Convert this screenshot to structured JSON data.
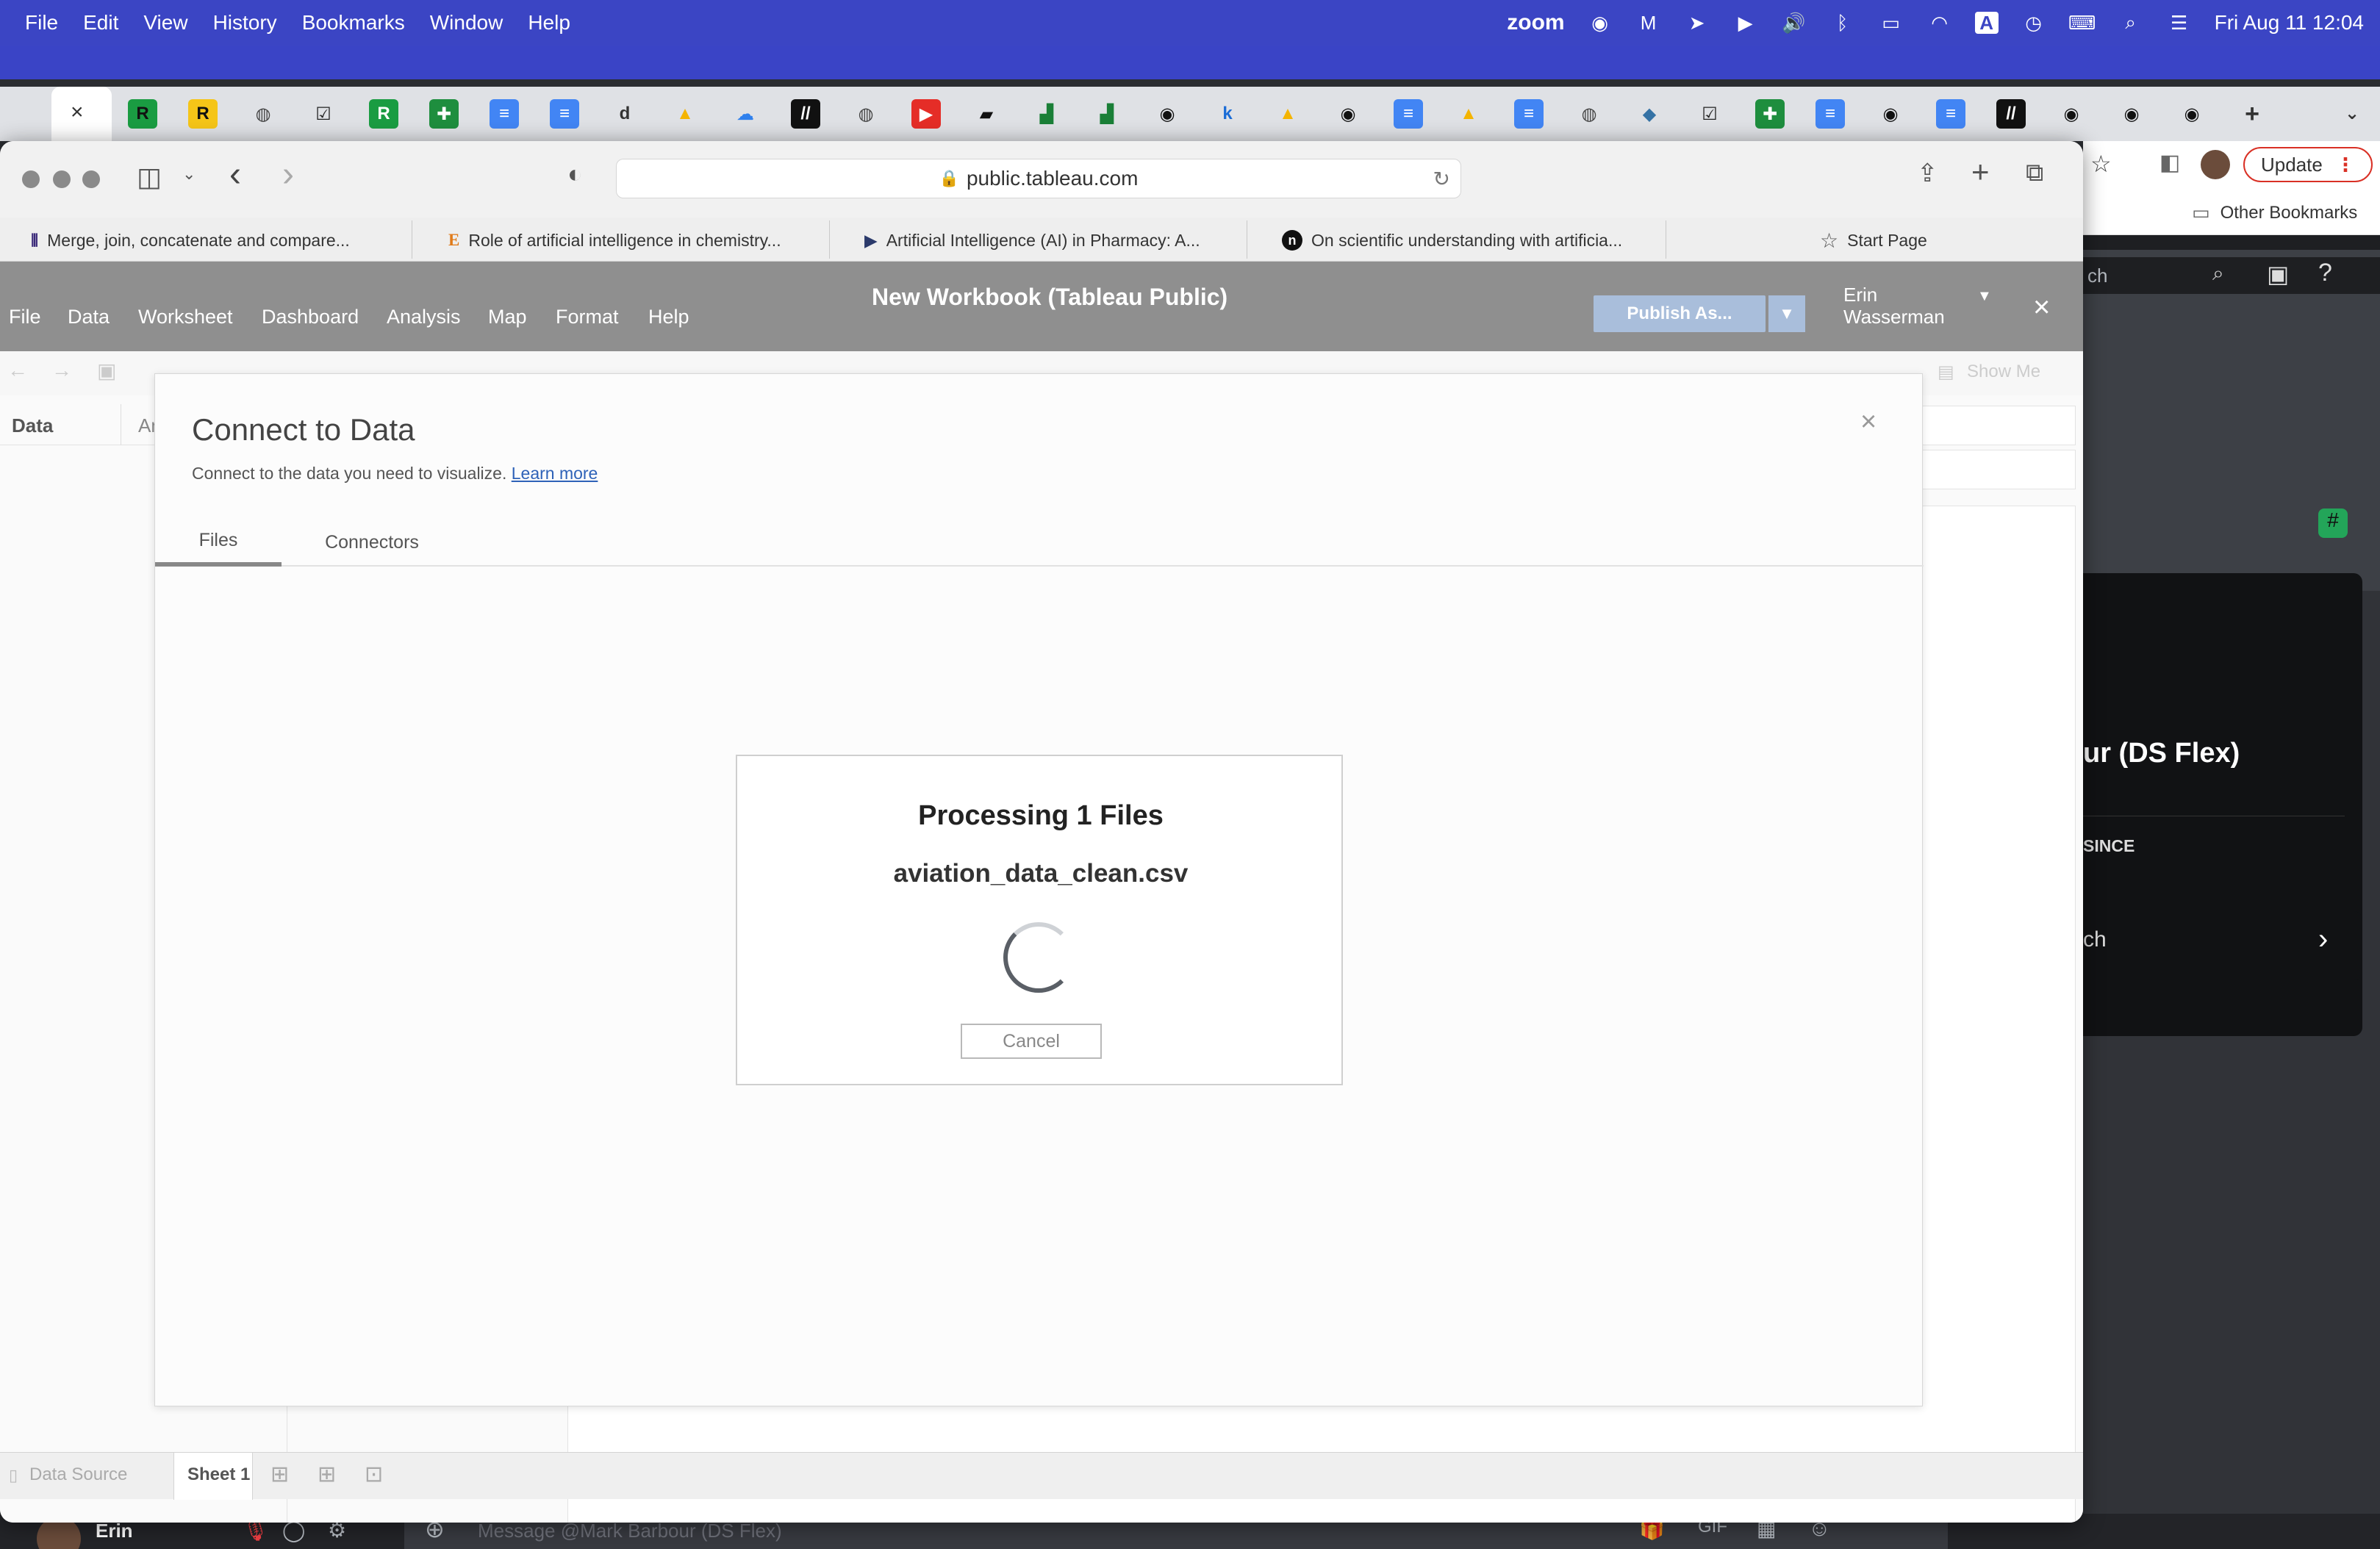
{
  "menubar": {
    "items": [
      "File",
      "Edit",
      "View",
      "History",
      "Bookmarks",
      "Window",
      "Help"
    ],
    "zoom_label": "zoom",
    "clock": "Fri Aug 11  12:04"
  },
  "safari": {
    "url": "public.tableau.com",
    "favorites": [
      "Merge, join, concatenate and compare...",
      "Role of artificial intelligence in chemistry...",
      "Artificial Intelligence (AI) in Pharmacy: A...",
      "On scientific understanding with artificia..."
    ],
    "start_page": "Start Page"
  },
  "chrome": {
    "update_label": "Update",
    "other_bookmarks": "Other Bookmarks"
  },
  "tableau": {
    "menu": [
      "File",
      "Data",
      "Worksheet",
      "Dashboard",
      "Analysis",
      "Map",
      "Format",
      "Help"
    ],
    "title": "New Workbook (Tableau Public)",
    "publish_label": "Publish As...",
    "user_first": "Erin",
    "user_last": "Wasserman",
    "show_me": "Show Me",
    "data_pane": "Data",
    "data_pane_tab2": "An",
    "data_source_tab": "Data Source",
    "sheet_tab": "Sheet 1"
  },
  "dialog": {
    "title": "Connect to Data",
    "subtitle": "Connect to the data you need to visualize.",
    "learn_more": "Learn more",
    "tabs": [
      "Files",
      "Connectors"
    ]
  },
  "processing": {
    "title": "Processing 1 Files",
    "filename": "aviation_data_clean.csv",
    "cancel_label": "Cancel"
  },
  "discord": {
    "search_fragment": "ch",
    "channel_title": "ur (DS Flex)",
    "since_label": "SINCE",
    "message_placeholder": "Message @Mark Barbour (DS Flex)",
    "user_name": "Erin"
  }
}
